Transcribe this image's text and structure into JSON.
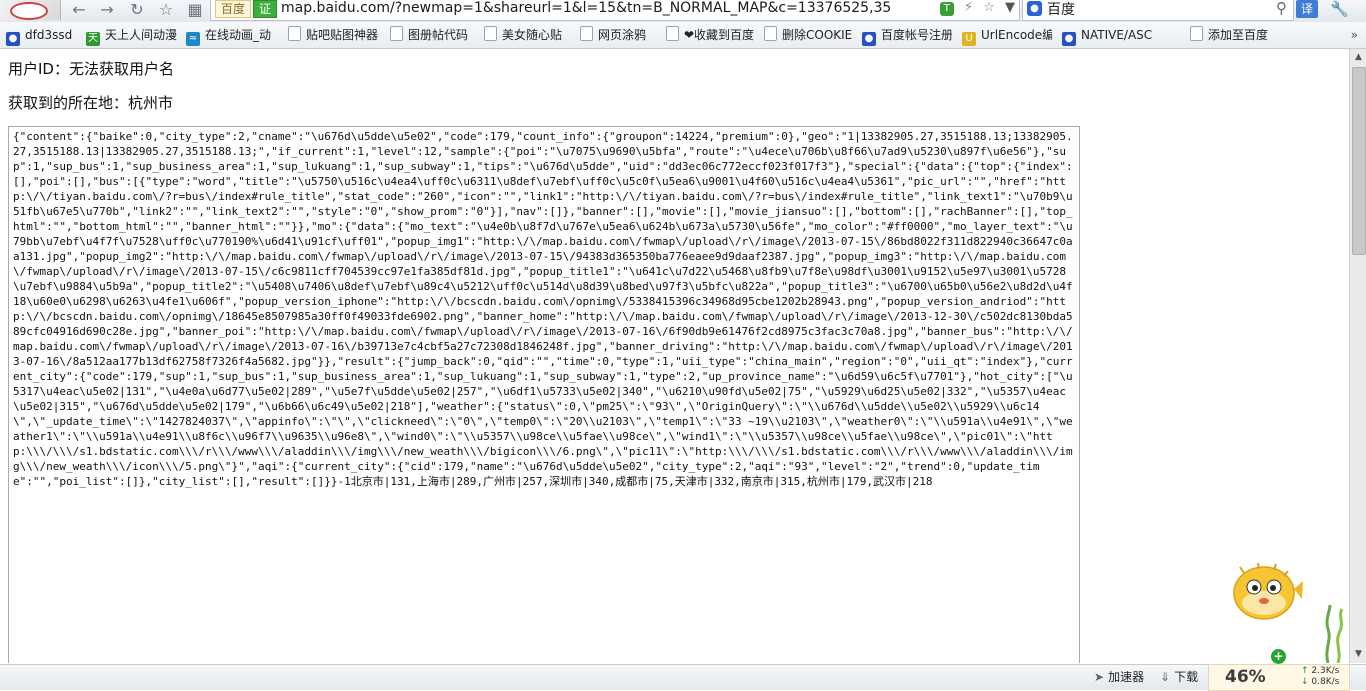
{
  "browser": {
    "site_badge": "百度",
    "site_badge_verified": "证",
    "url": "map.baidu.com/?newmap=1&shareurl=1&l=15&tn=B_NORMAL_MAP&c=13376525,35",
    "search_value": "百度",
    "translate_label": "译",
    "icons": [
      "back-icon",
      "forward-icon",
      "refresh-icon",
      "favorite-icon",
      "apps-icon",
      "shield-icon",
      "lightning-icon",
      "star-icon",
      "dropdown-icon",
      "search-icon",
      "tools-icon"
    ]
  },
  "bookmarks": [
    {
      "label": "dfd3ssd",
      "icon": "paw"
    },
    {
      "label": "天上人间动漫",
      "icon": "green"
    },
    {
      "label": "在线动画_动",
      "icon": "blue"
    },
    {
      "label": "贴吧贴图神器",
      "icon": "page"
    },
    {
      "label": "图册帖代码",
      "icon": "page"
    },
    {
      "label": "美女随心贴",
      "icon": "page"
    },
    {
      "label": "网页涂鸦",
      "icon": "page"
    },
    {
      "label": "❤收藏到百度",
      "icon": "page"
    },
    {
      "label": "删除COOKIE",
      "icon": "page"
    },
    {
      "label": "百度帐号注册",
      "icon": "paw"
    },
    {
      "label": "UrlEncode编",
      "icon": "yellow"
    },
    {
      "label": "NATIVE/ASC",
      "icon": "paw"
    },
    {
      "label": "添加至百度",
      "icon": "page"
    }
  ],
  "bookmarks_more": "»",
  "page": {
    "user_line": "用户ID：无法获取用户名",
    "location_line": "获取到的所在地：杭州市",
    "json_output": "{\"content\":{\"baike\":0,\"city_type\":2,\"cname\":\"\\u676d\\u5dde\\u5e02\",\"code\":179,\"count_info\":{\"groupon\":14224,\"premium\":0},\"geo\":\"1|13382905.27,3515188.13;13382905.27,3515188.13|13382905.27,3515188.13;\",\"if_current\":1,\"level\":12,\"sample\":{\"poi\":\"\\u7075\\u9690\\u5bfa\",\"route\":\"\\u4ece\\u706b\\u8f66\\u7ad9\\u5230\\u897f\\u6e56\"},\"sup\":1,\"sup_bus\":1,\"sup_business_area\":1,\"sup_lukuang\":1,\"sup_subway\":1,\"tips\":\"\\u676d\\u5dde\",\"uid\":\"dd3ec06c772eccf023f017f3\"},\"special\":{\"data\":{\"top\":{\"index\":[],\"poi\":[],\"bus\":[{\"type\":\"word\",\"title\":\"\\u5750\\u516c\\u4ea4\\uff0c\\u6311\\u8def\\u7ebf\\uff0c\\u5c0f\\u5ea6\\u9001\\u4f60\\u516c\\u4ea4\\u5361\",\"pic_url\":\"\",\"href\":\"http:\\/\\/tiyan.baidu.com\\/?r=bus\\/index#rule_title\",\"stat_code\":\"260\",\"icon\":\"\",\"link1\":\"http:\\/\\/tiyan.baidu.com\\/?r=bus\\/index#rule_title\",\"link_text1\":\"\\u70b9\\u51fb\\u67e5\\u770b\",\"link2\":\"\",\"link_text2\":\"\",\"style\":\"0\",\"show_prom\":\"0\"}],\"nav\":[]},\"banner\":[],\"movie\":[],\"movie_jiansuo\":[],\"bottom\":[],\"rachBanner\":[],\"top_html\":\"\",\"bottom_html\":\"\",\"banner_html\":\"\"}},\"mo\":{\"data\":{\"mo_text\":\"\\u4e0b\\u8f7d\\u767e\\u5ea6\\u624b\\u673a\\u5730\\u56fe\",\"mo_color\":\"#ff0000\",\"mo_layer_text\":\"\\u79bb\\u7ebf\\u4f7f\\u7528\\uff0c\\u770190%\\u6d41\\u91cf\\uff01\",\"popup_img1\":\"http:\\/\\/map.baidu.com\\/fwmap\\/upload\\/r\\/image\\/2013-07-15\\/86bd8022f311d822940c36647c0aa131.jpg\",\"popup_img2\":\"http:\\/\\/map.baidu.com\\/fwmap\\/upload\\/r\\/image\\/2013-07-15\\/94383d365350ba776eaee9d9daaf2387.jpg\",\"popup_img3\":\"http:\\/\\/map.baidu.com\\/fwmap\\/upload\\/r\\/image\\/2013-07-15\\/c6c9811cff704539cc97e1fa385df81d.jpg\",\"popup_title1\":\"\\u641c\\u7d22\\u5468\\u8fb9\\u7f8e\\u98df\\u3001\\u9152\\u5e97\\u3001\\u5728\\u7ebf\\u9884\\u5b9a\",\"popup_title2\":\"\\u5408\\u7406\\u8def\\u7ebf\\u89c4\\u5212\\uff0c\\u514d\\u8d39\\u8bed\\u97f3\\u5bfc\\u822a\",\"popup_title3\":\"\\u6700\\u65b0\\u56e2\\u8d2d\\u4f18\\u60e0\\u6298\\u6263\\u4fe1\\u606f\",\"popup_version_iphone\":\"http:\\/\\/bcscdn.baidu.com\\/opnimg\\/5338415396c34968d95cbe1202b28943.png\",\"popup_version_andriod\":\"http:\\/\\/bcscdn.baidu.com\\/opnimg\\/18645e8507985a30ff0f49033fde6902.png\",\"banner_home\":\"http:\\/\\/map.baidu.com\\/fwmap\\/upload\\/r\\/image\\/2013-12-30\\/c502dc8130bda589cfc04916d690c28e.jpg\",\"banner_poi\":\"http:\\/\\/map.baidu.com\\/fwmap\\/upload\\/r\\/image\\/2013-07-16\\/6f90db9e61476f2cd8975c3fac3c70a8.jpg\",\"banner_bus\":\"http:\\/\\/map.baidu.com\\/fwmap\\/upload\\/r\\/image\\/2013-07-16\\/b39713e7c4cbf5a27c72308d1846248f.jpg\",\"banner_driving\":\"http:\\/\\/map.baidu.com\\/fwmap\\/upload\\/r\\/image\\/2013-07-16\\/8a512aa177b13df62758f7326f4a5682.jpg\"}},\"result\":{\"jump_back\":0,\"qid\":\"\",\"time\":0,\"type\":1,\"uii_type\":\"china_main\",\"region\":\"0\",\"uii_qt\":\"index\"},\"current_city\":{\"code\":179,\"sup\":1,\"sup_bus\":1,\"sup_business_area\":1,\"sup_lukuang\":1,\"sup_subway\":1,\"type\":2,\"up_province_name\":\"\\u6d59\\u6c5f\\u7701\"},\"hot_city\":[\"\\u5317\\u4eac\\u5e02|131\",\"\\u4e0a\\u6d77\\u5e02|289\",\"\\u5e7f\\u5dde\\u5e02|257\",\"\\u6df1\\u5733\\u5e02|340\",\"\\u6210\\u90fd\\u5e02|75\",\"\\u5929\\u6d25\\u5e02|332\",\"\\u5357\\u4eac\\u5e02|315\",\"\\u676d\\u5dde\\u5e02|179\",\"\\u6b66\\u6c49\\u5e02|218\"],\"weather\":{\"status\\\":0,\\\"pm25\\\":\\\"93\\\",\\\"OriginQuery\\\":\\\"\\\\u676d\\\\u5dde\\\\u5e02\\\\u5929\\\\u6c14\\\",\\\"_update_time\\\":\\\"1427824037\\\",\\\"appinfo\\\":\\\"\\\",\\\"clickneed\\\":\\\"0\\\",\\\"temp0\\\":\\\"20\\\\u2103\\\",\\\"temp1\\\":\\\"33 ~19\\\\u2103\\\",\\\"weather0\\\":\\\"\\\\u591a\\\\u4e91\\\",\\\"weather1\\\":\\\"\\\\u591a\\\\u4e91\\\\u8f6c\\\\u96f7\\\\u9635\\\\u96e8\\\",\\\"wind0\\\":\\\"\\\\u5357\\\\u98ce\\\\u5fae\\\\u98ce\\\",\\\"wind1\\\":\\\"\\\\u5357\\\\u98ce\\\\u5fae\\\\u98ce\\\",\\\"pic01\\\":\\\"http:\\\\\\/\\\\\\/s1.bdstatic.com\\\\\\/r\\\\\\/www\\\\\\/aladdin\\\\\\/img\\\\\\/new_weath\\\\\\/bigicon\\\\\\/6.png\\\",\\\"pic11\\\":\\\"http:\\\\\\/\\\\\\/s1.bdstatic.com\\\\\\/r\\\\\\/www\\\\\\/aladdin\\\\\\/img\\\\\\/new_weath\\\\\\/icon\\\\\\/5.png\\\"}\",\"aqi\":{\"current_city\":{\"cid\":179,\"name\":\"\\u676d\\u5dde\\u5e02\",\"city_type\":2,\"aqi\":\"93\",\"level\":\"2\",\"trend\":0,\"update_time\":\"\",\"poi_list\":[]},\"city_list\":[],\"result\":[]}}-1北京市|131,上海市|289,广州市|257,深圳市|340,成都市|75,天津市|332,南京市|315,杭州市|179,武汉市|218"
  },
  "statusbar": {
    "accelerator_label": "加速器",
    "download_label": "下载",
    "speed_percent": "46%",
    "upload_speed": "2.3K/s",
    "download_speed": "0.8K/s",
    "plus_label": "+"
  },
  "colors": {
    "accent": "#2851c8",
    "verified_green": "#3cae3c",
    "speed_bg": "#fff8e6"
  }
}
